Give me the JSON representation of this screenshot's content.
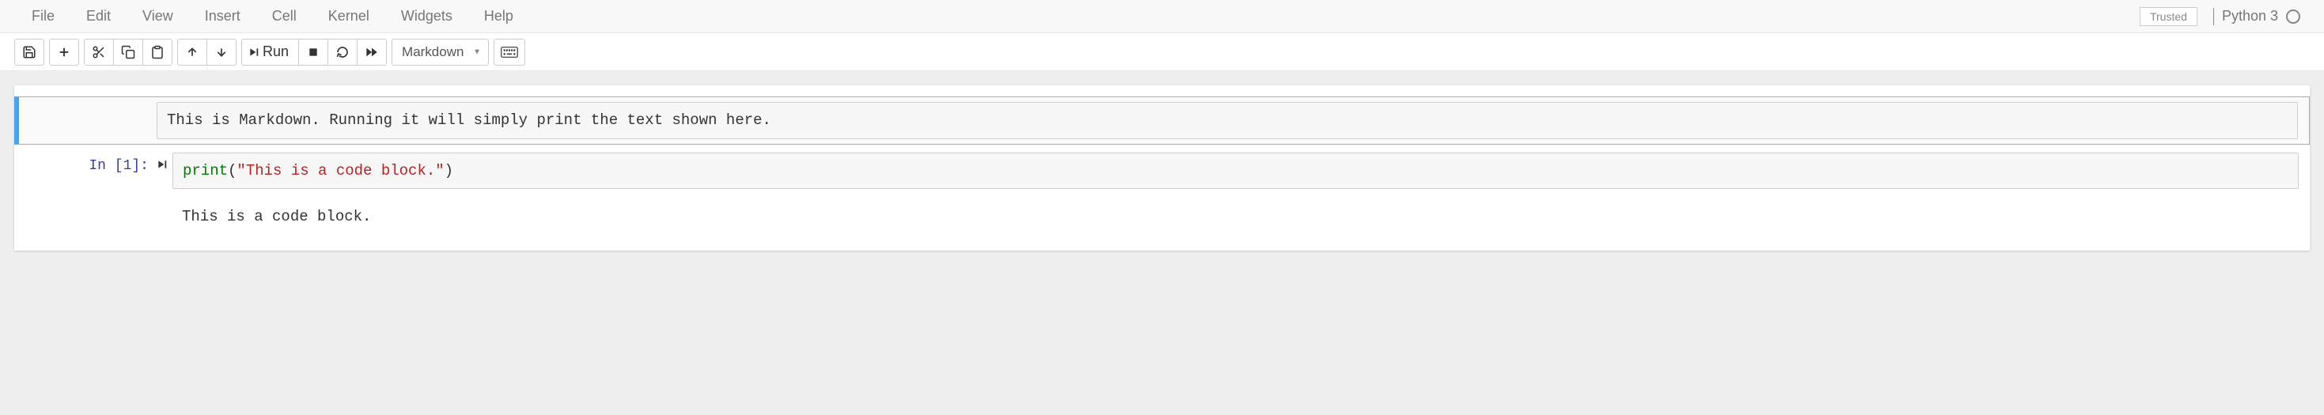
{
  "menubar": {
    "items": [
      "File",
      "Edit",
      "View",
      "Insert",
      "Cell",
      "Kernel",
      "Widgets",
      "Help"
    ]
  },
  "trusted_label": "Trusted",
  "kernel": {
    "name": "Python 3"
  },
  "toolbar": {
    "run_label": "Run",
    "cell_type_selected": "Markdown"
  },
  "cells": [
    {
      "type": "markdown",
      "selected": true,
      "source": "This is Markdown. Running it will simply print the text shown here."
    },
    {
      "type": "code",
      "execution_count": 1,
      "prompt": "In [1]:",
      "source": {
        "func": "print",
        "paren_open": "(",
        "string": "\"This is a code block.\"",
        "paren_close": ")"
      },
      "output": "This is a code block."
    }
  ]
}
